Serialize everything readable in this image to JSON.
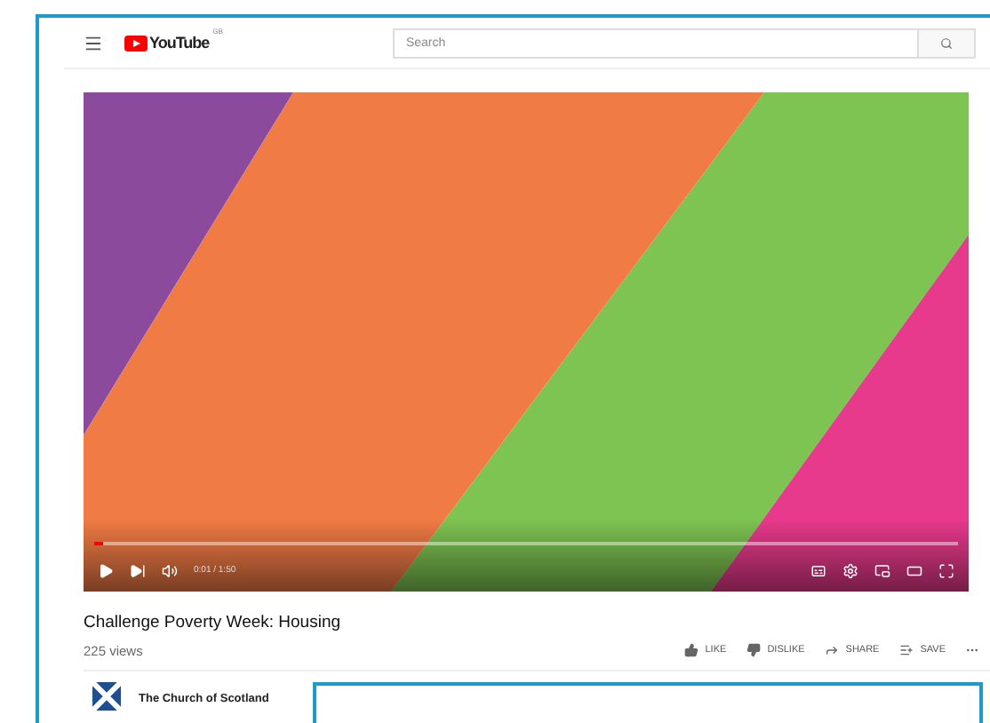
{
  "header": {
    "logo": "YouTube",
    "region": "GB",
    "search": {
      "placeholder": "Search"
    }
  },
  "video": {
    "kind": "picture",
    "time": "0:01 / 1:50",
    "progress": {
      "level": 0.01
    }
  },
  "title": "Challenge Poverty Week: Housing",
  "views": "225 views",
  "actions": [
    {
      "kind": "like",
      "label": "LIKE"
    },
    {
      "kind": "dislike",
      "label": "DISLIKE"
    },
    {
      "kind": "share",
      "label": "SHARE"
    },
    {
      "kind": "save",
      "label": "SAVE"
    },
    {
      "kind": "more"
    }
  ],
  "channel": {
    "name": "The Church of Scotland"
  }
}
